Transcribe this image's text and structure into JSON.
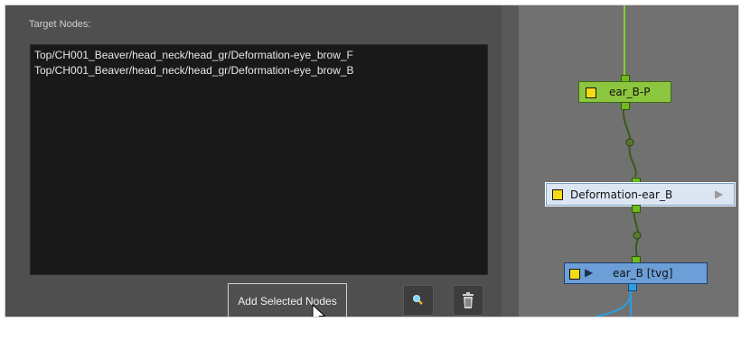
{
  "target_nodes": {
    "label": "Target Nodes:",
    "items": [
      "Top/CH001_Beaver/head_neck/head_gr/Deformation-eye_brow_F",
      "Top/CH001_Beaver/head_neck/head_gr/Deformation-eye_brow_B"
    ]
  },
  "buttons": {
    "add_selected": "Add Selected Nodes",
    "locate_icon": "magnifier-icon",
    "delete_icon": "trash-icon"
  },
  "node_view": {
    "nodes": [
      {
        "label": "ear_B-P",
        "color": "#8cc63f"
      },
      {
        "label": "Deformation-ear_B",
        "color": "#dce6f2"
      },
      {
        "label": "ear_B [tvg]",
        "color": "#6c9fd8"
      }
    ]
  },
  "colors": {
    "panel_bg": "#4f4f4f",
    "list_bg": "#191919",
    "node_view_bg": "#717171",
    "green_link": "#6fbc1f",
    "blue_link": "#2e9de0"
  }
}
